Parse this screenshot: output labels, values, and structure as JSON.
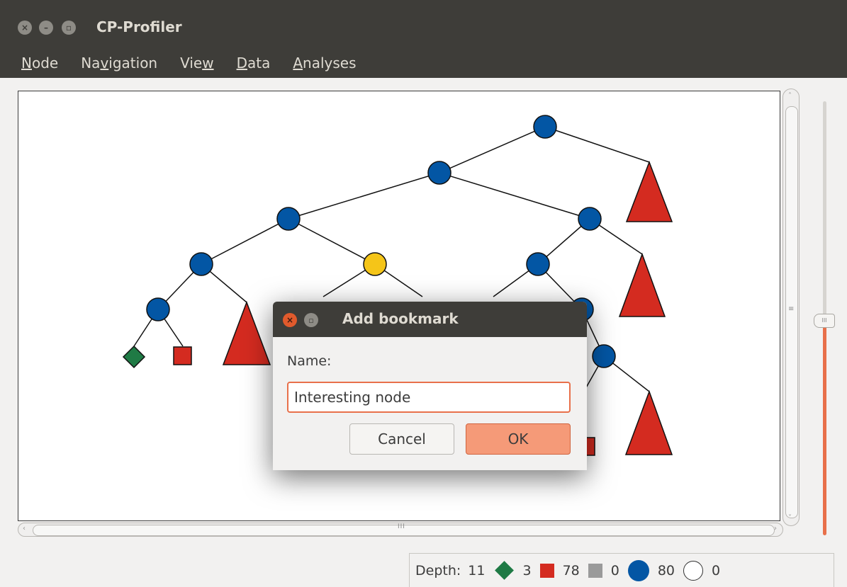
{
  "window": {
    "title": "CP-Profiler",
    "controls": [
      "close-icon",
      "minimize-icon",
      "maximize-icon"
    ]
  },
  "menu": {
    "items": [
      {
        "label": "Node",
        "mnemonic": "N"
      },
      {
        "label": "Navigation",
        "mnemonic": "v"
      },
      {
        "label": "View",
        "mnemonic": "w"
      },
      {
        "label": "Data",
        "mnemonic": "D"
      },
      {
        "label": "Analyses",
        "mnemonic": "A"
      }
    ]
  },
  "legend": {
    "depth_label": "Depth:",
    "depth_value": "11",
    "solved_count": "3",
    "failed_count": "78",
    "skipped_count": "0",
    "branch_count": "80",
    "unexplored_count": "0"
  },
  "dialog": {
    "title": "Add bookmark",
    "name_label": "Name:",
    "name_value": "Interesting node",
    "cancel_label": "Cancel",
    "ok_label": "OK"
  },
  "colors": {
    "branch_node": "#0356a4",
    "selected_node": "#f5c518",
    "failed": "#d42b20",
    "solved": "#1f7a45",
    "accent": "#e8704a",
    "titlebar": "#3e3d39"
  },
  "zoom": {
    "level_fraction": 0.5
  }
}
